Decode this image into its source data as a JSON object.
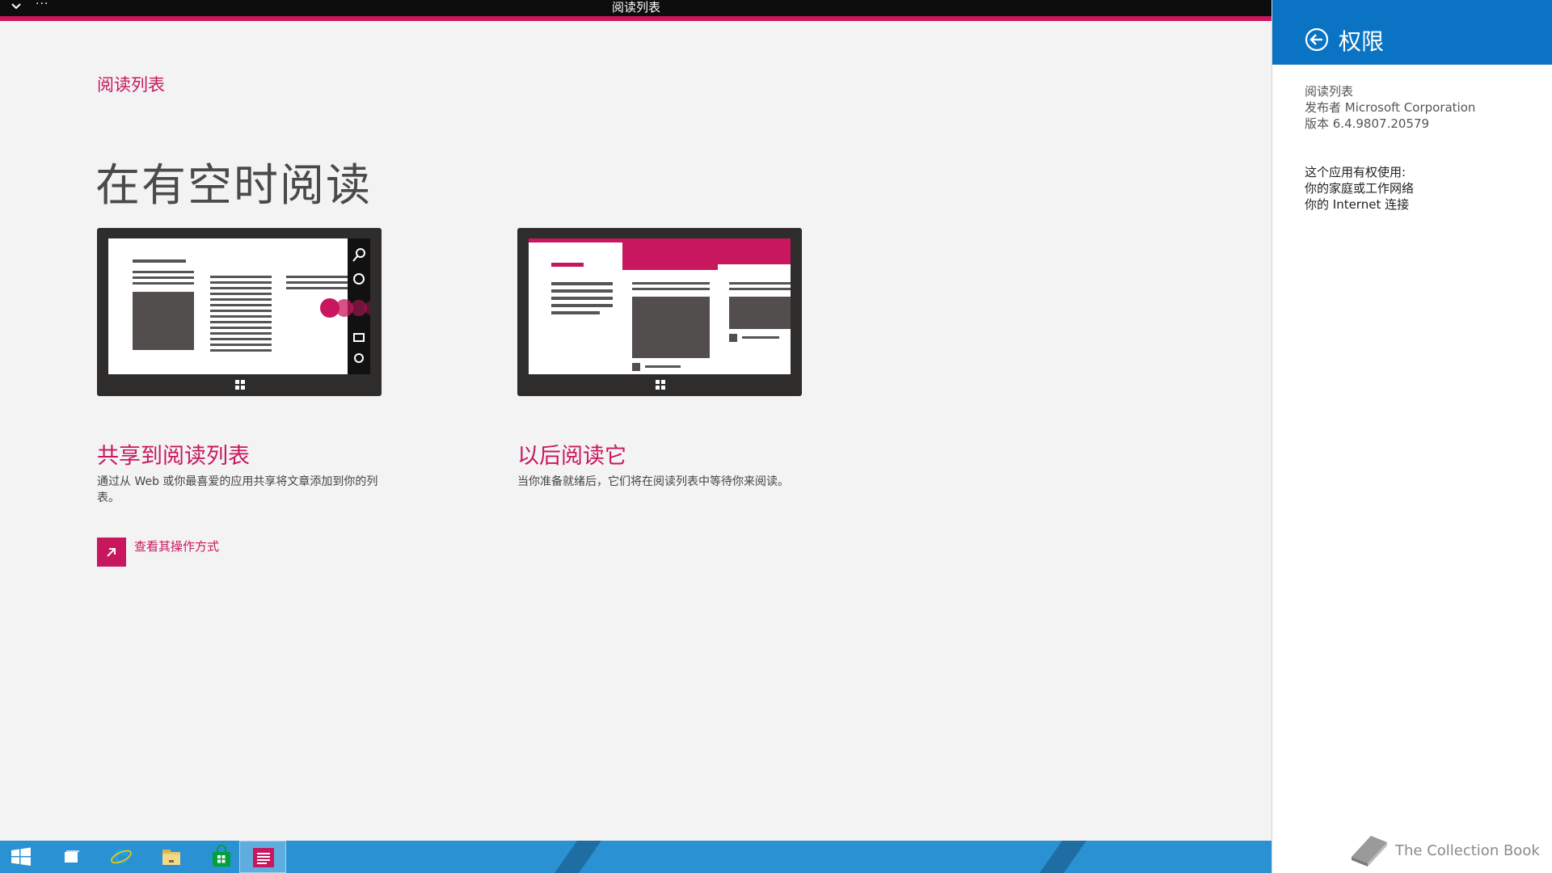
{
  "window": {
    "title": "阅读列表",
    "menu_glyph": "···"
  },
  "app": {
    "name": "阅读列表",
    "hero": "在有空时阅读",
    "features": [
      {
        "title": "共享到阅读列表",
        "description": "通过从 Web 或你最喜爱的应用共享将文章添加到你的列表。"
      },
      {
        "title": "以后阅读它",
        "description": "当你准备就绪后，它们将在阅读列表中等待你来阅读。"
      }
    ],
    "howto_label": "查看其操作方式"
  },
  "flyout": {
    "title": "权限",
    "app_name": "阅读列表",
    "publisher": "发布者 Microsoft Corporation",
    "version": "版本 6.4.9807.20579",
    "permissions_heading": "这个应用有权使用:",
    "permissions": [
      "你的家庭或工作网络",
      "你的 Internet 连接"
    ]
  },
  "watermark": {
    "text": "The Collection Book"
  },
  "taskbar": {
    "items": [
      "start-icon",
      "task-view-icon",
      "internet-explorer-icon",
      "file-explorer-icon",
      "store-icon",
      "reading-list-icon"
    ]
  },
  "colors": {
    "accent": "#c8175e",
    "flyout_header": "#0a73c4",
    "taskbar": "#2a92d3",
    "device": "#2f2c2c"
  }
}
